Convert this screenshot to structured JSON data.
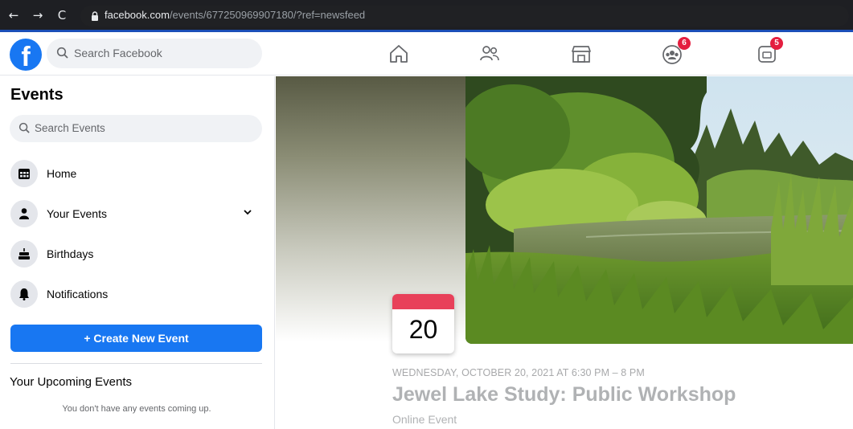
{
  "browser": {
    "url_domain": "facebook.com",
    "url_path": "/events/677250969907180/?ref=newsfeed"
  },
  "header": {
    "search_placeholder": "Search Facebook",
    "nav": [
      {
        "icon": "home-icon"
      },
      {
        "icon": "friends-icon"
      },
      {
        "icon": "marketplace-icon"
      },
      {
        "icon": "groups-icon",
        "badge": "6"
      },
      {
        "icon": "gaming-icon",
        "badge": "5"
      }
    ]
  },
  "sidebar": {
    "title": "Events",
    "search_placeholder": "Search Events",
    "items": [
      {
        "label": "Home",
        "icon": "calendar-grid-icon"
      },
      {
        "label": "Your Events",
        "icon": "person-icon"
      },
      {
        "label": "Birthdays",
        "icon": "cake-icon"
      },
      {
        "label": "Notifications",
        "icon": "bell-icon"
      }
    ],
    "create_label": "+ Create New Event",
    "upcoming_title": "Your Upcoming Events",
    "upcoming_empty": "You don't have any events coming up."
  },
  "event": {
    "day": "20",
    "date_line": "WEDNESDAY, OCTOBER 20, 2021 AT 6:30 PM – 8 PM",
    "title": "Jewel Lake Study: Public Workshop",
    "subtitle": "Online Event"
  },
  "colors": {
    "brand": "#1877f2",
    "badge": "#e41e3f",
    "calendar_top": "#e8415a"
  }
}
